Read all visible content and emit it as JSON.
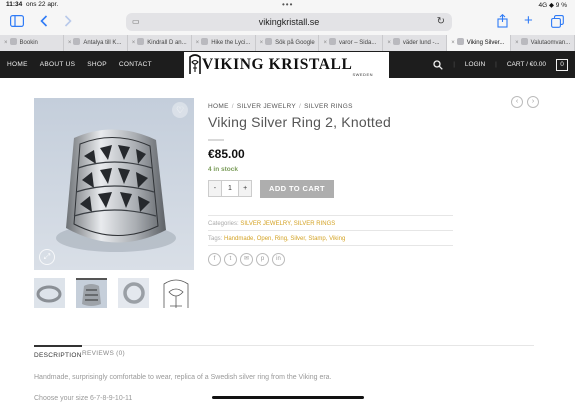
{
  "status_bar": {
    "time": "11:34",
    "date": "ons 22 apr.",
    "right": "4G ◆ 9 %"
  },
  "browser": {
    "url": "vikingkristall.se",
    "tabs": [
      {
        "label": "Bookin",
        "active": false
      },
      {
        "label": "Antalya till K...",
        "active": false
      },
      {
        "label": "Kindrall D an...",
        "active": false
      },
      {
        "label": "Hike the Lyci...",
        "active": false
      },
      {
        "label": "Sök på Google",
        "active": false
      },
      {
        "label": "varor – Sida...",
        "active": false
      },
      {
        "label": "väder lund -...",
        "active": false
      },
      {
        "label": "Viking Silver...",
        "active": true
      },
      {
        "label": "Valutaomvan...",
        "active": false
      }
    ]
  },
  "site_nav": {
    "items": [
      "HOME",
      "ABOUT US",
      "SHOP",
      "CONTACT"
    ],
    "logo_text": "VIKING KRISTALL",
    "logo_sub": "SWEDEN",
    "login": "LOGIN",
    "cart": "CART / €0.00",
    "cart_count": "0"
  },
  "breadcrumb": [
    "HOME",
    "SILVER JEWELRY",
    "SILVER RINGS"
  ],
  "product": {
    "title": "Viking Silver Ring 2, Knotted",
    "price": "€85.00",
    "stock": "4 in stock",
    "quantity": "1",
    "add_to_cart": "ADD TO CART",
    "categories_label": "Categories:",
    "categories": "SILVER JEWELRY, SILVER RINGS",
    "tags_label": "Tags:",
    "tags": "Handmade, Open, Ring, Silver, Stamp, Viking"
  },
  "tabs": {
    "description": "DESCRIPTION",
    "reviews": "REVIEWS (0)"
  },
  "description": {
    "line1": "Handmade, surprisingly comfortable to wear, replica of a Swedish silver ring from the Viking era.",
    "line2": "Choose your size 6-7-8-9-10-11"
  },
  "colors": {
    "nav_bg": "#1d1d1d",
    "accent_gold": "#d4a325",
    "stock_green": "#7a9c59",
    "ios_blue": "#2f7bf6"
  }
}
